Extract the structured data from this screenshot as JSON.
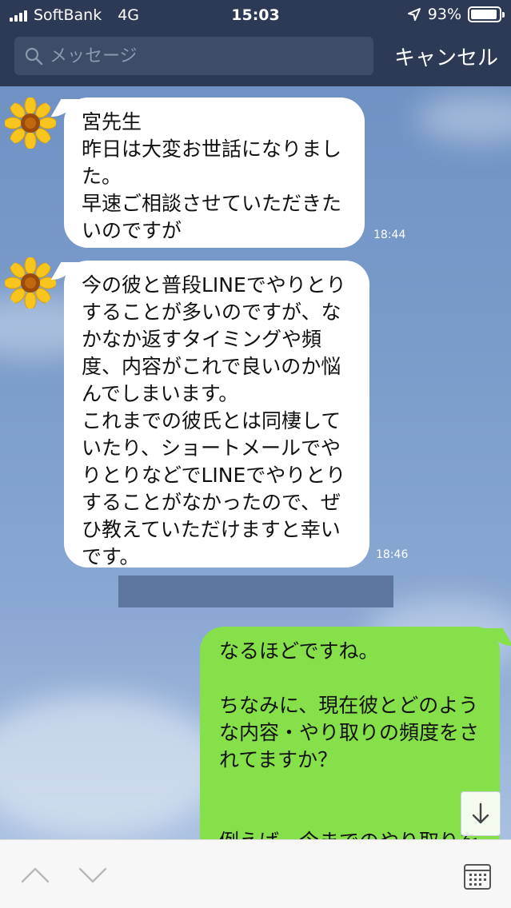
{
  "status_bar": {
    "carrier": "SoftBank",
    "network": "4G",
    "time": "15:03",
    "battery": "93%",
    "battery_level": 0.93,
    "location_icon": "location-arrow-icon"
  },
  "search": {
    "placeholder": "メッセージ",
    "cancel_label": "キャンセル",
    "icon": "search-icon"
  },
  "messages": [
    {
      "direction": "in",
      "text": "宮先生\n昨日は大変お世話になりまし\nた。\n早速ご相談させていただきた\nいのですが",
      "time": "18:44"
    },
    {
      "direction": "in",
      "text": "今の彼と普段LINEでやりとり\nすることが多いのですが、な\nかなか返すタイミングや頻\n度、内容がこれで良いのか悩\nんでしまいます。\nこれまでの彼氏とは同棲して\nいたり、ショートメールでや\nりとりなどでLINEでやりとり\nすることがなかったので、ぜ\nひ教えていただけますと幸い\nです。",
      "time": "18:46"
    },
    {
      "direction": "out",
      "text": "なるほどですね。\n\nちなみに、現在彼とどのよう\nな内容・やり取りの頻度をさ\nれてますか？\n\n\n例えば、今までのやり取りを"
    }
  ],
  "icons": {
    "avatar": "sunflower-avatar",
    "scroll_down": "arrow-down-icon",
    "prev": "chevron-up-icon",
    "next": "chevron-down-icon",
    "calendar": "calendar-icon"
  },
  "colors": {
    "header_bg": "#2c3a55",
    "incoming_bubble": "#ffffff",
    "outgoing_bubble": "#86e04a",
    "chat_bg": "#7b9bc8"
  }
}
